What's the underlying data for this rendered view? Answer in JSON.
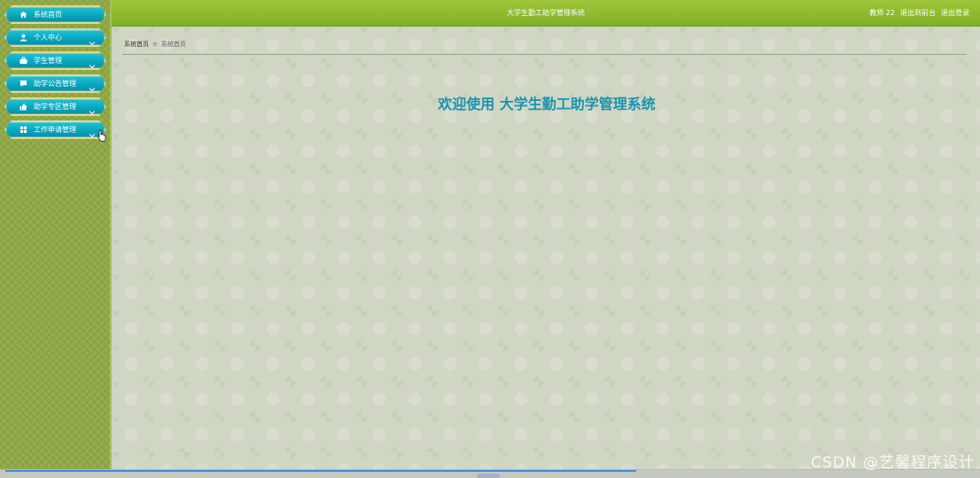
{
  "header": {
    "app_title": "大学生勤工助学管理系统",
    "user_label": "教师 22",
    "front_link": "退出到前台",
    "logout_link": "退出登录"
  },
  "sidebar": {
    "items": [
      {
        "label": "系统首页",
        "icon": "home-icon"
      },
      {
        "label": "个人中心",
        "icon": "user-icon"
      },
      {
        "label": "学生管理",
        "icon": "briefcase-icon"
      },
      {
        "label": "助学公告管理",
        "icon": "chat-icon"
      },
      {
        "label": "助学专区管理",
        "icon": "thumbs-up-icon"
      },
      {
        "label": "工作申请管理",
        "icon": "grid-icon"
      }
    ]
  },
  "breadcrumb": {
    "home": "系统首页",
    "separator": "≡",
    "current": "系统首页"
  },
  "main": {
    "welcome": "欢迎使用 大学生勤工助学管理系统"
  },
  "watermark": "CSDN @艺馨程序设计",
  "colors": {
    "header_green": "#8db92e",
    "menu_teal": "#0aa6be",
    "welcome_text": "#1a93b0",
    "main_bg": "#cfd6c3"
  }
}
